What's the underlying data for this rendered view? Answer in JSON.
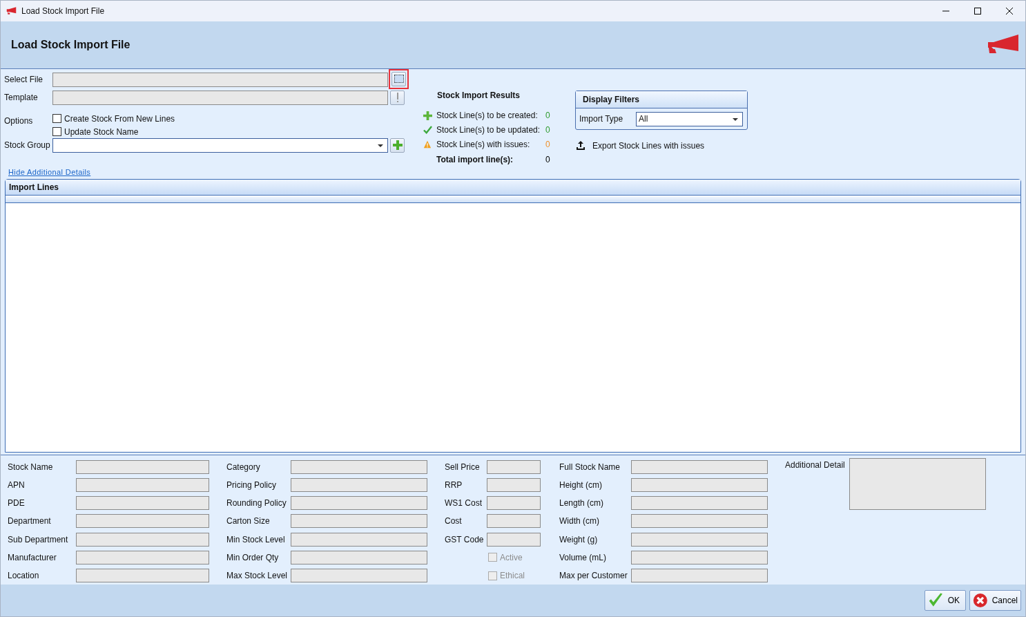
{
  "window": {
    "title": "Load Stock Import File"
  },
  "header": {
    "title": "Load Stock Import File"
  },
  "form": {
    "select_file": {
      "label": "Select File",
      "highlighted": true
    },
    "template": {
      "label": "Template"
    },
    "options": {
      "label": "Options",
      "items": [
        {
          "label": "Create Stock From New Lines",
          "checked": false
        },
        {
          "label": "Update Stock Name",
          "checked": false
        }
      ]
    },
    "stock_group": {
      "label": "Stock Group"
    },
    "details_link": "Hide Additional Details"
  },
  "results": {
    "title": "Stock Import Results",
    "rows": [
      {
        "kind": "created",
        "label": "Stock Line(s) to be created:",
        "value": "0"
      },
      {
        "kind": "updated",
        "label": "Stock Line(s) to be updated:",
        "value": "0"
      },
      {
        "kind": "issues",
        "label": "Stock Line(s) with issues:",
        "value": "0"
      },
      {
        "kind": "total",
        "label": "Total import line(s):",
        "value": "0"
      }
    ]
  },
  "display_filters": {
    "title": "Display Filters",
    "import_type": {
      "label": "Import Type",
      "value": "All"
    }
  },
  "export_link": "Export Stock Lines with issues",
  "import_lines": {
    "title": "Import Lines"
  },
  "details": {
    "columns": [
      {
        "fields": [
          {
            "kind": "field",
            "label": "Stock Name"
          },
          {
            "kind": "field",
            "label": "APN"
          },
          {
            "kind": "field",
            "label": "PDE"
          },
          {
            "kind": "field",
            "label": "Department"
          },
          {
            "kind": "field",
            "label": "Sub Department"
          },
          {
            "kind": "field",
            "label": "Manufacturer"
          },
          {
            "kind": "field",
            "label": "Location"
          }
        ]
      },
      {
        "fields": [
          {
            "kind": "field",
            "label": "Category"
          },
          {
            "kind": "field",
            "label": "Pricing Policy"
          },
          {
            "kind": "field",
            "label": "Rounding Policy"
          },
          {
            "kind": "field",
            "label": "Carton Size"
          },
          {
            "kind": "field",
            "label": "Min Stock Level"
          },
          {
            "kind": "field",
            "label": "Min Order Qty"
          },
          {
            "kind": "field",
            "label": "Max Stock Level"
          }
        ]
      },
      {
        "fields": [
          {
            "kind": "field",
            "label": "Sell Price"
          },
          {
            "kind": "field",
            "label": "RRP"
          },
          {
            "kind": "field",
            "label": "WS1 Cost"
          },
          {
            "kind": "field",
            "label": "Cost"
          },
          {
            "kind": "field",
            "label": "GST Code"
          },
          {
            "kind": "checkbox",
            "label": "Active",
            "checked": false,
            "disabled": true
          },
          {
            "kind": "checkbox",
            "label": "Ethical",
            "checked": false,
            "disabled": true
          }
        ]
      },
      {
        "fields": [
          {
            "kind": "field",
            "label": "Full Stock Name"
          },
          {
            "kind": "field",
            "label": "Height (cm)"
          },
          {
            "kind": "field",
            "label": "Length (cm)"
          },
          {
            "kind": "field",
            "label": "Width (cm)"
          },
          {
            "kind": "field",
            "label": "Weight (g)"
          },
          {
            "kind": "field",
            "label": "Volume (mL)"
          },
          {
            "kind": "field",
            "label": "Max per Customer"
          }
        ]
      },
      {
        "fields": [
          {
            "kind": "textarea",
            "label": "Additional Detail"
          }
        ]
      }
    ]
  },
  "buttons": [
    {
      "kind": "ok",
      "label": "OK"
    },
    {
      "kind": "cancel",
      "label": "Cancel"
    }
  ]
}
